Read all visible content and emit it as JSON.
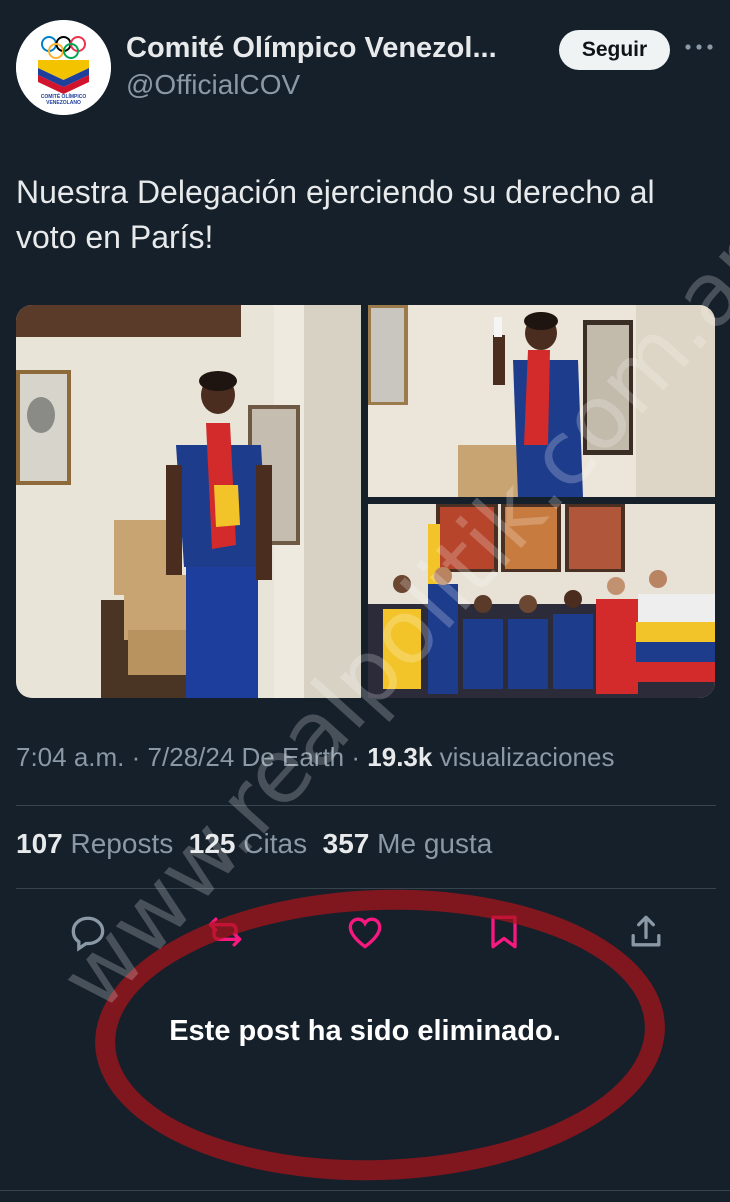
{
  "account": {
    "display_name": "Comité Olímpico Venezol...",
    "handle": "@OfficialCOV",
    "logo_text": "COMITÉ OLÍMPICO VENEZOLANO",
    "follow_label": "Seguir",
    "more_icon": "more-horizontal-icon"
  },
  "post": {
    "text": "Nuestra Delegación ejerciendo su derecho al voto en París!",
    "time": "7:04 a.m.",
    "date": "7/28/24",
    "source": "De Earth",
    "views_count": "19.3k",
    "views_label": "visualizaciones"
  },
  "stats": {
    "reposts_count": "107",
    "reposts_label": "Reposts",
    "quotes_count": "125",
    "quotes_label": "Citas",
    "likes_count": "357",
    "likes_label": "Me gusta"
  },
  "actions": {
    "reply_icon": "reply-icon",
    "repost_icon": "repost-icon",
    "like_icon": "heart-icon",
    "bookmark_icon": "bookmark-icon",
    "share_icon": "share-icon",
    "repost_color": "#f91880",
    "like_color": "#f91880"
  },
  "notice": {
    "deleted_text": "Este post ha sido eliminado."
  },
  "overlay": {
    "watermark": "www.realpolitik.com.ar",
    "ellipse_color": "#aa1419"
  }
}
